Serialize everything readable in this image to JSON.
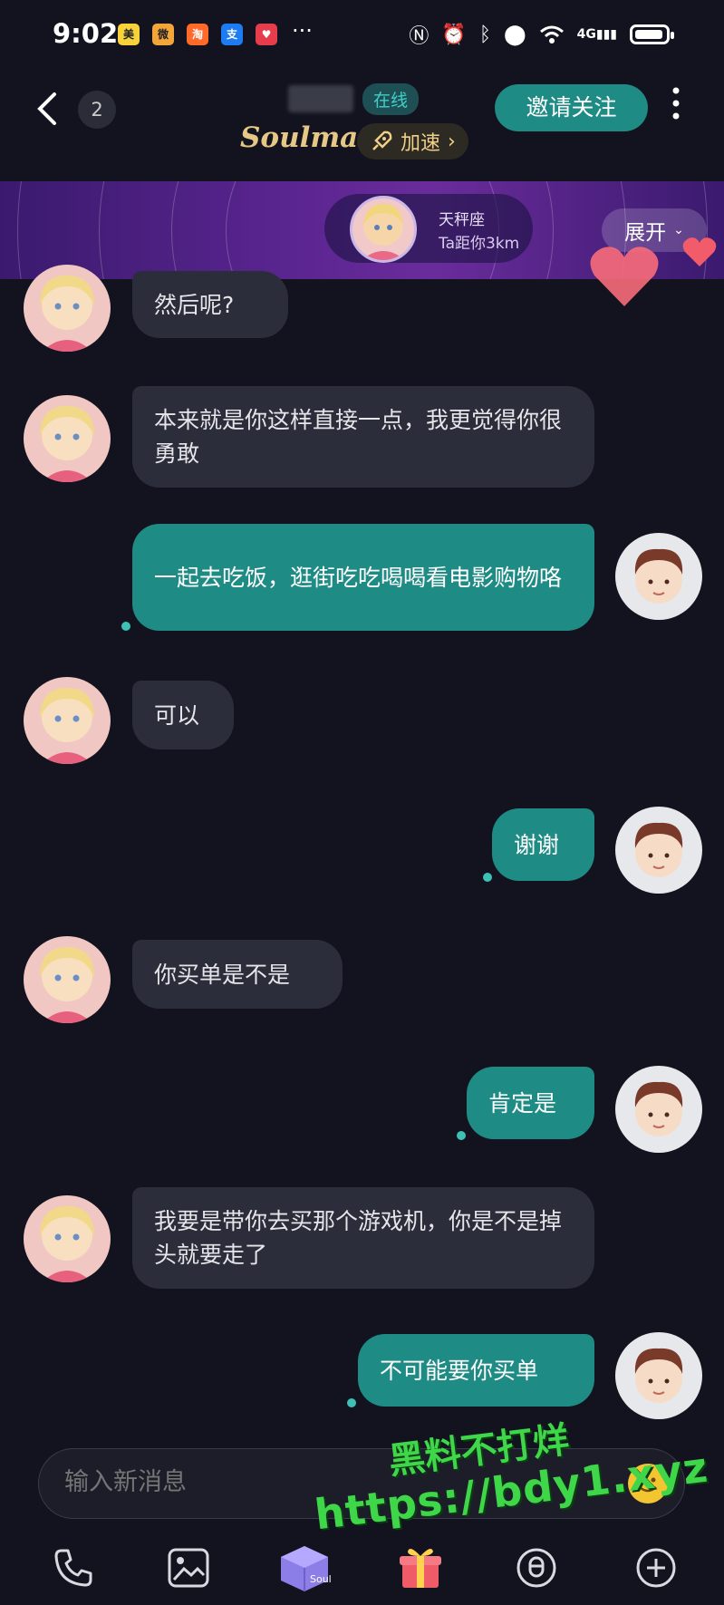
{
  "status_bar": {
    "time": "9:02",
    "app_icons": [
      "meituan-icon",
      "weibo-icon",
      "taobao-icon",
      "alipay-icon",
      "health-icon"
    ],
    "more": "···",
    "network": "4G"
  },
  "header": {
    "unread_count": "2",
    "online_label": "在线",
    "soulmate_label": "Soulmate",
    "speedup_label": "加速",
    "invite_button": "邀请关注"
  },
  "banner": {
    "zodiac": "天秤座",
    "distance": "Ta距你3km",
    "expand_label": "展开"
  },
  "messages": [
    {
      "side": "left",
      "text": "然后呢?"
    },
    {
      "side": "left",
      "text": "本来就是你这样直接一点，我更觉得你很勇敢"
    },
    {
      "side": "right",
      "text": "一起去吃饭，逛街吃吃喝喝看电影购物咯"
    },
    {
      "side": "left",
      "text": "可以"
    },
    {
      "side": "right",
      "text": "谢谢"
    },
    {
      "side": "left",
      "text": "你买单是不是"
    },
    {
      "side": "right",
      "text": "肯定是"
    },
    {
      "side": "left",
      "text": "我要是带你去买那个游戏机，你是不是掉头就要走了"
    },
    {
      "side": "right",
      "text": "不可能要你买单"
    }
  ],
  "input": {
    "placeholder": "输入新消息"
  },
  "watermark": {
    "line1": "黑料不打烊",
    "line2": "https://bdy1.xyz"
  },
  "toolbar": {
    "icons": [
      "phone-icon",
      "image-icon",
      "soul-box-icon",
      "gift-icon",
      "voice-icon",
      "plus-icon"
    ],
    "soul_label": "Soul"
  },
  "colors": {
    "background": "#12131f",
    "accent": "#1f8b85",
    "bubble_left": "#2c2d3a",
    "watermark": "#3fd64a"
  }
}
